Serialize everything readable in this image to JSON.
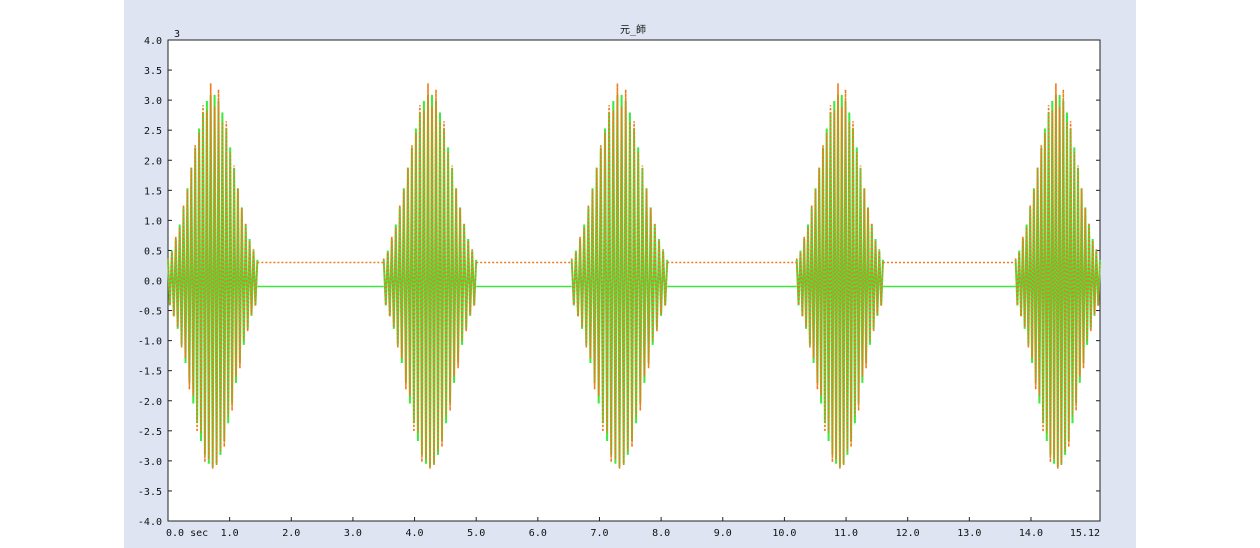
{
  "chart_data": {
    "type": "line",
    "title": "元_師",
    "corner_label": "3",
    "x_unit": "sec",
    "x_end_label": "15.12",
    "xlim": [
      0.0,
      15.12
    ],
    "ylim": [
      -4.0,
      4.0
    ],
    "x_ticks": [
      0.0,
      1.0,
      2.0,
      3.0,
      4.0,
      5.0,
      6.0,
      7.0,
      8.0,
      9.0,
      10.0,
      11.0,
      12.0,
      13.0,
      14.0,
      15.12
    ],
    "y_ticks": [
      4.0,
      3.5,
      3.0,
      2.5,
      2.0,
      1.5,
      1.0,
      0.5,
      0.0,
      -0.5,
      -1.0,
      -1.5,
      -2.0,
      -2.5,
      -3.0,
      -3.5,
      -4.0
    ],
    "x_tick_labels": [
      "0.0 sec",
      "1.0",
      "2.0",
      "3.0",
      "4.0",
      "5.0",
      "6.0",
      "7.0",
      "8.0",
      "9.0",
      "10.0",
      "11.0",
      "12.0",
      "13.0",
      "14.0",
      "15.12"
    ],
    "y_tick_labels": [
      "4.0",
      "3.5",
      "3.0",
      "2.5",
      "2.0",
      "1.5",
      "1.0",
      "0.5",
      "0.0",
      "-0.5",
      "-1.0",
      "-1.5",
      "-2.0",
      "-2.5",
      "-3.0",
      "-3.5",
      "-4.0"
    ],
    "grid": false,
    "series": [
      {
        "color": "#3ee83e",
        "style": "solid",
        "baseline": -0.1,
        "bursts": [
          {
            "start": 0.0,
            "end": 1.45,
            "peak": 3.1
          },
          {
            "start": 3.5,
            "end": 5.0,
            "peak": 3.1
          },
          {
            "start": 6.55,
            "end": 8.1,
            "peak": 3.1
          },
          {
            "start": 10.2,
            "end": 11.6,
            "peak": 3.1
          },
          {
            "start": 13.75,
            "end": 15.12,
            "peak": 3.1
          }
        ]
      },
      {
        "color": "#f07a1a",
        "style": "dotted",
        "baseline": 0.3,
        "bursts": [
          {
            "start": 0.0,
            "end": 1.45,
            "peak": 3.3
          },
          {
            "start": 3.5,
            "end": 5.0,
            "peak": 3.3
          },
          {
            "start": 6.55,
            "end": 8.1,
            "peak": 3.3
          },
          {
            "start": 10.2,
            "end": 11.6,
            "peak": 3.3
          },
          {
            "start": 13.75,
            "end": 15.12,
            "peak": 3.3
          }
        ]
      }
    ]
  }
}
